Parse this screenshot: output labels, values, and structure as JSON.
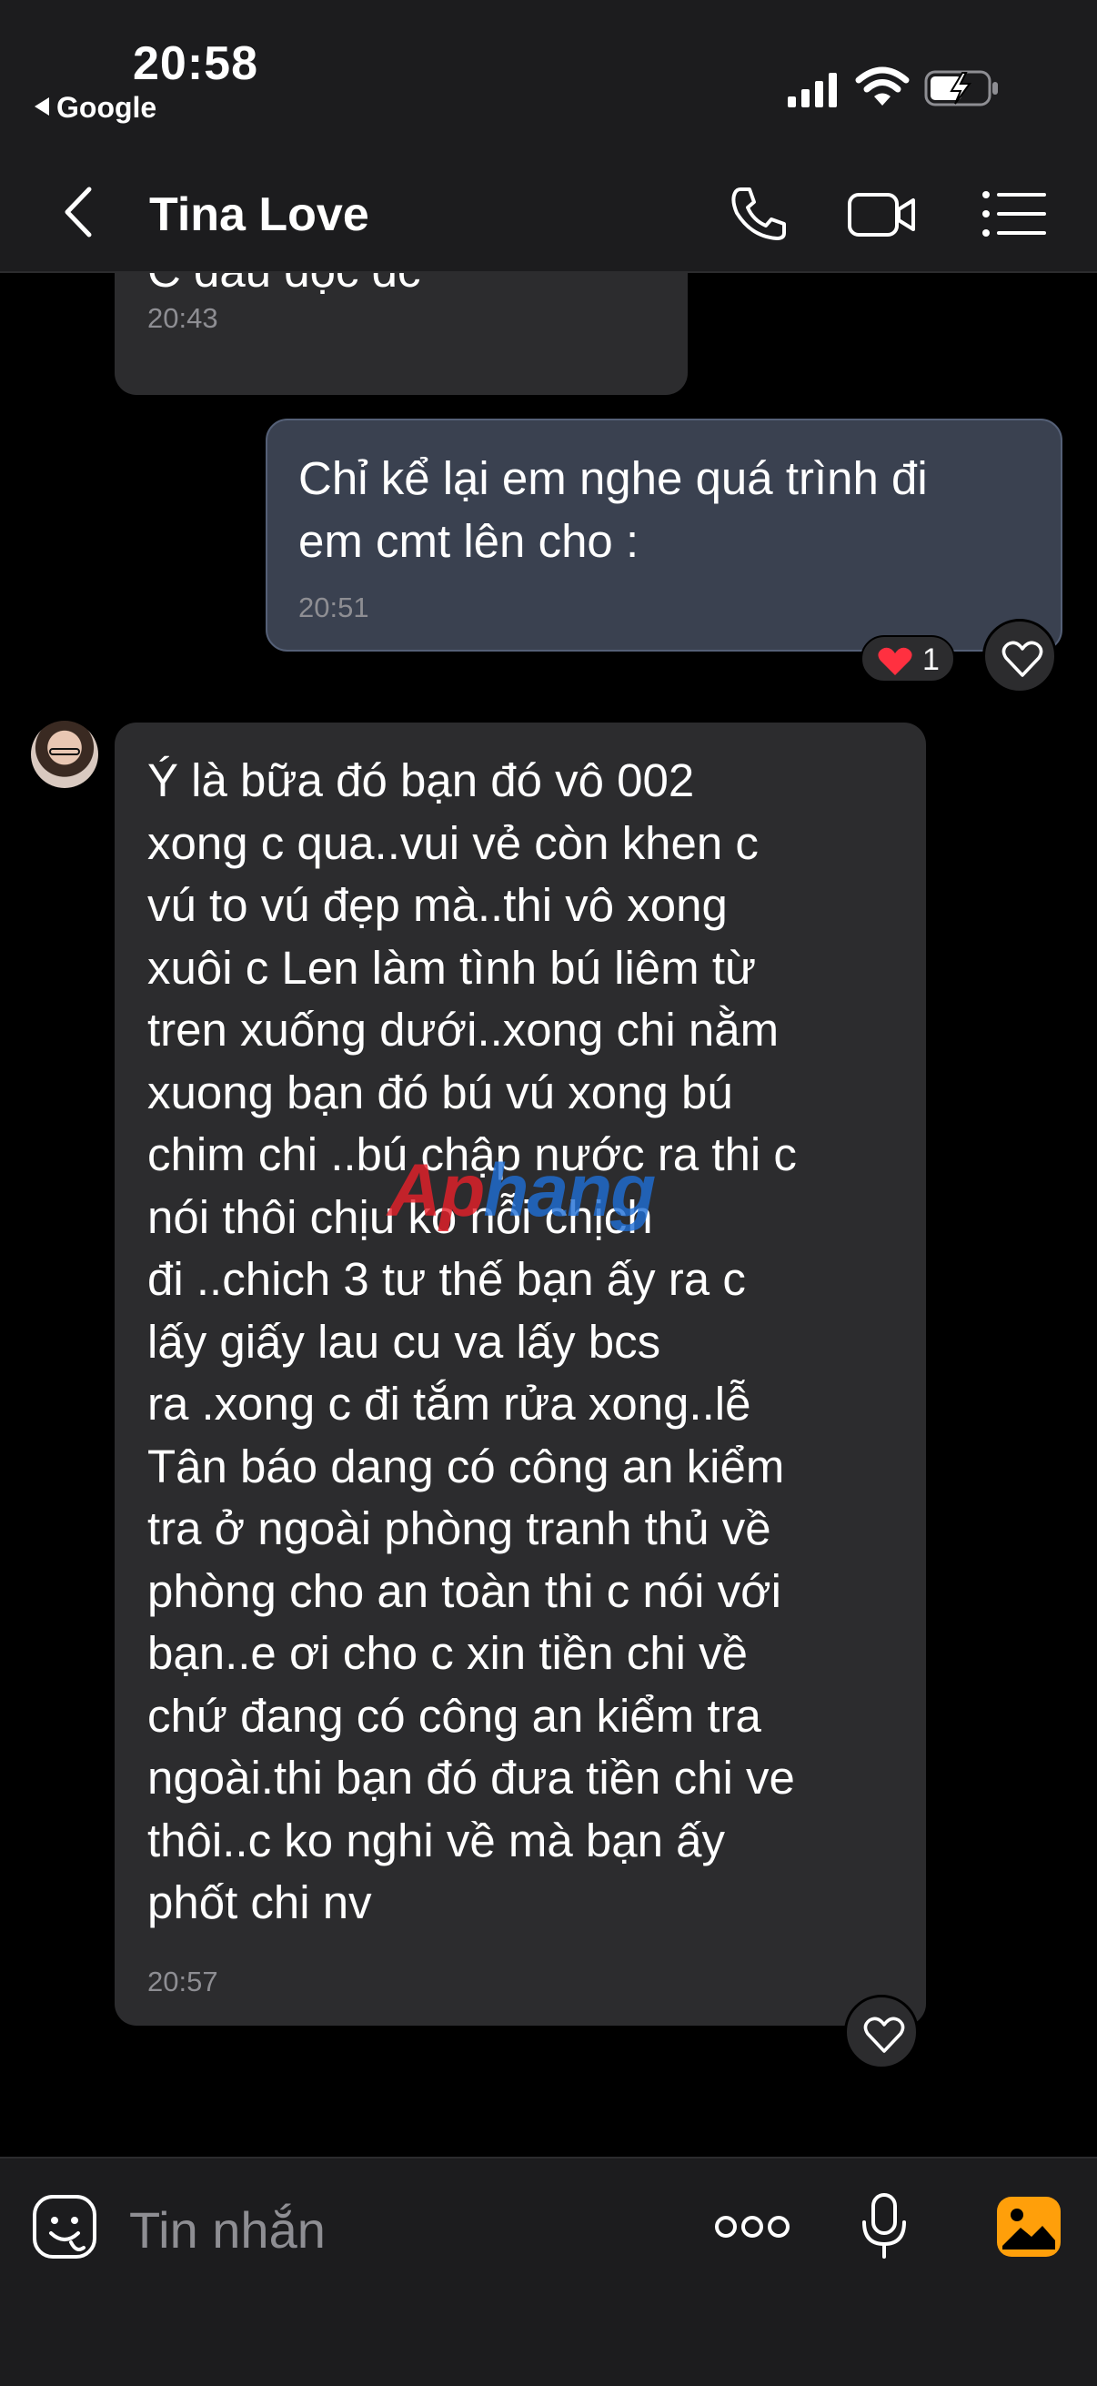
{
  "status_bar": {
    "time": "20:58",
    "back_app": "Google"
  },
  "header": {
    "title": "Tina Love"
  },
  "messages": [
    {
      "direction": "incoming",
      "text": "C dau dộc dc",
      "time": "20:43"
    },
    {
      "direction": "outgoing",
      "text": "Chỉ kể lại em nghe quá trình đi\nem cmt lên cho :",
      "time": "20:51",
      "reaction_count": "1"
    },
    {
      "direction": "incoming",
      "text": "Ý là bữa đó bạn đó vô 002\nxong c qua..vui vẻ còn khen c\nvú to vú đẹp mà..thi vô xong\nxuôi c Len làm tình bú liêm từ\ntren xuống dưới..xong chi nằm\nxuong bạn đó bú vú xong bú\nchim chi ..bú chập nước ra thi c\nnói thôi chịu ko nỗi chịch\nđi ..chich 3 tư thế bạn ấy ra c\nlấy giấy lau cu va lấy bcs\nra .xong c đi tắm rửa xong..lễ\nTân báo dang có công an kiểm\ntra ở ngoài phòng tranh thủ về\nphòng cho an toàn thi c nói với\nbạn..e ơi cho c xin tiền chi về\nchứ đang có công an kiểm tra\nngoài.thi bạn đó đưa tiền chi ve\nthôi..c ko nghi về mà bạn ấy\nphốt chi nv",
      "time": "20:57"
    }
  ],
  "watermark": {
    "part1": "Ap",
    "part2": "hang"
  },
  "input": {
    "placeholder": "Tin nhắn"
  },
  "colors": {
    "background": "#000000",
    "bar": "#1c1c1e",
    "incoming_bubble": "#2c2c2e",
    "outgoing_bubble": "#3a4150",
    "heart": "#ff3040",
    "image_button": "#ff9f0a"
  }
}
